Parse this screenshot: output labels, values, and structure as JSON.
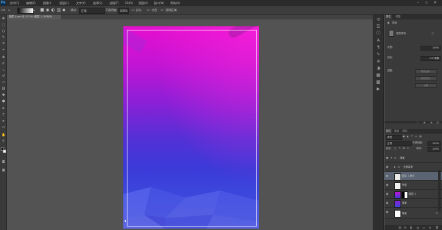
{
  "menubar": {
    "logo": "Ps",
    "items": [
      "文件(F)",
      "编辑(E)",
      "图像(I)",
      "图层(L)",
      "文字(Y)",
      "选择(S)",
      "滤镜(T)",
      "3D(D)",
      "视图(V)",
      "窗口(W)",
      "帮助(H)"
    ]
  },
  "options": {
    "mode_label": "模式:",
    "mode_value": "正常",
    "opacity_label": "不透明度:",
    "opacity_value": "100%",
    "reverse_label": "反向",
    "dither_label": "仿色",
    "transparency_label": "透明区域"
  },
  "document": {
    "tab_title": "图层 1.psd @ 33.3% (图层 1, RGB/8)"
  },
  "tools": [
    "move",
    "marquee",
    "lasso",
    "quick-select",
    "crop",
    "eyedropper",
    "healing",
    "brush",
    "stamp",
    "history-brush",
    "eraser",
    "gradient",
    "blur",
    "dodge",
    "pen",
    "type",
    "path-select",
    "shape",
    "hand",
    "zoom"
  ],
  "properties_panel": {
    "tabs": [
      "属性",
      "调整"
    ],
    "title": "蒙版",
    "section_label": "图层蒙版",
    "density_label": "浓度:",
    "density_value": "100%",
    "feather_label": "羽化:",
    "feather_value": "0.0 像素",
    "refine_label": "调整:",
    "buttons": [
      "蒙版边缘...",
      "颜色范围...",
      "反相"
    ]
  },
  "layers_panel": {
    "tabs": [
      "图层",
      "通道",
      "路径"
    ],
    "filter_label": "类型",
    "blend_mode": "正常",
    "opacity_label": "不透明度:",
    "opacity_value": "100%",
    "lock_label": "锁定:",
    "fill_label": "填充:",
    "fill_value": "100%",
    "layers": [
      {
        "name": "背景",
        "type": "group",
        "expanded": true
      },
      {
        "name": "头部装饰",
        "type": "group",
        "expanded": false
      },
      {
        "name": "图层 1 拷贝",
        "type": "layer",
        "selected": true
      },
      {
        "name": "外框",
        "type": "layer"
      },
      {
        "name": "图层 1",
        "type": "layer",
        "has_mask": true
      },
      {
        "name": "背景",
        "type": "layer"
      },
      {
        "name": "背景",
        "type": "layer"
      }
    ]
  },
  "colors": {
    "artboard_top": "#e60fcf",
    "artboard_bottom": "#4a4fd8",
    "selected_layer": "#5a6473"
  }
}
